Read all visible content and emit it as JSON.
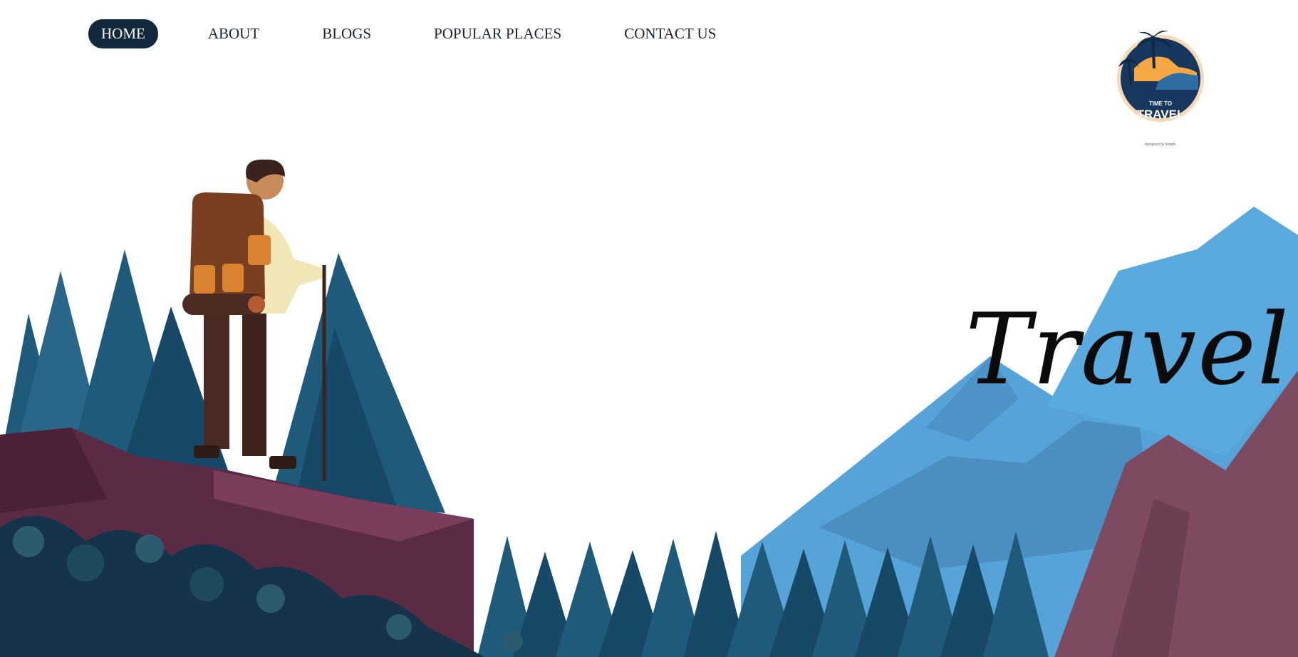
{
  "nav": {
    "items": [
      {
        "label": "HOME",
        "active": true
      },
      {
        "label": "ABOUT",
        "active": false
      },
      {
        "label": "BLOGS",
        "active": false
      },
      {
        "label": "POPULAR PLACES",
        "active": false
      },
      {
        "label": "CONTACT US",
        "active": false
      }
    ]
  },
  "logo": {
    "line1": "TIME TO",
    "line2": "TRAVEL",
    "credit": "designed by freepik"
  },
  "hero": {
    "title": "Travel"
  },
  "colors": {
    "nav_active_bg": "#13283d",
    "pine": "#1f5a7a",
    "pine_dark": "#174868",
    "rock": "#5b2a45",
    "mountain": "#55a3d8",
    "mountain_shadow": "#4b8fc2",
    "mauve": "#7d4a61"
  }
}
